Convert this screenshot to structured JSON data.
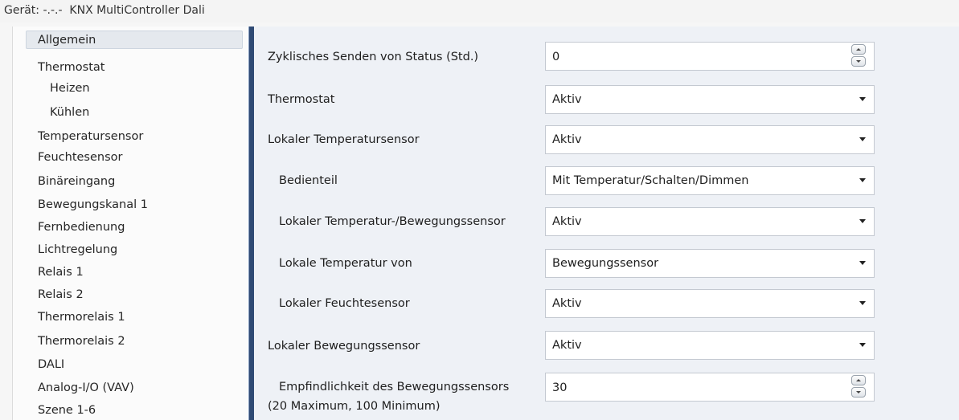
{
  "titlebar": {
    "text": "Gerät: -.-.-  KNX MultiController Dali"
  },
  "sidebar": {
    "items": [
      {
        "label": "Allgemein"
      },
      {
        "label": "Thermostat"
      },
      {
        "label": "Heizen"
      },
      {
        "label": "Kühlen"
      },
      {
        "label": "Temperatursensor"
      },
      {
        "label": "Feuchtesensor"
      },
      {
        "label": "Binäreingang"
      },
      {
        "label": "Bewegungskanal 1"
      },
      {
        "label": "Fernbedienung"
      },
      {
        "label": "Lichtregelung"
      },
      {
        "label": "Relais 1"
      },
      {
        "label": "Relais 2"
      },
      {
        "label": "Thermorelais 1"
      },
      {
        "label": "Thermorelais 2"
      },
      {
        "label": "DALI"
      },
      {
        "label": "Analog-I/O (VAV)"
      },
      {
        "label": "Szene 1-6"
      }
    ],
    "selected": "Allgemein"
  },
  "params": [
    {
      "label": "Zyklisches Senden von Status (Std.)",
      "value": "0",
      "type": "number"
    },
    {
      "label": "Thermostat",
      "value": "Aktiv",
      "type": "select"
    },
    {
      "label": "Lokaler Temperatursensor",
      "value": "Aktiv",
      "type": "select"
    },
    {
      "label": "Bedienteil",
      "value": "Mit Temperatur/Schalten/Dimmen",
      "type": "select"
    },
    {
      "label": "Lokaler Temperatur-/Bewegungssensor",
      "value": "Aktiv",
      "type": "select"
    },
    {
      "label": "Lokale Temperatur von",
      "value": "Bewegungssensor",
      "type": "select"
    },
    {
      "label": "Lokaler Feuchtesensor",
      "value": "Aktiv",
      "type": "select"
    },
    {
      "label": "Lokaler Bewegungssensor",
      "value": "Aktiv",
      "type": "select"
    },
    {
      "label": "Empfindlichkeit des Bewegungssensors",
      "label2": "(20 Maximum, 100 Minimum)",
      "value": "30",
      "type": "number"
    }
  ]
}
